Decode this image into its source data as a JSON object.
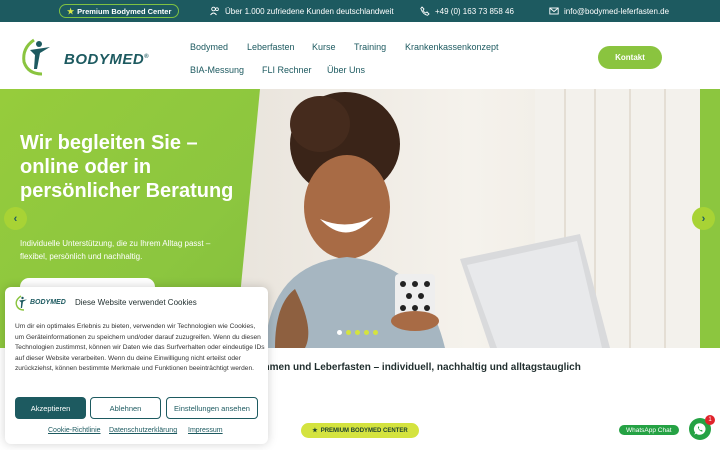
{
  "topbar": {
    "badge": "Premium Bodymed Center",
    "customers": "Über 1.000 zufriedene Kunden deutschlandweit",
    "phone": "+49 (0) 163 73 858 46",
    "email": "info@bodymed-leferfasten.de"
  },
  "header": {
    "logo_text": "BODYMED",
    "logo_mark": "®",
    "nav": [
      "Bodymed",
      "Leberfasten",
      "Kurse",
      "Training",
      "Krankenkassenkonzept",
      "BIA-Messung",
      "FLI Rechner",
      "Über Uns"
    ],
    "contact_button": "Kontakt"
  },
  "hero": {
    "title": "Wir begleiten Sie – online oder in persönlicher Beratung",
    "subtitle": "Individuelle Unterstützung, die zu Ihrem Alltag passt – flexibel, persönlich und nachhaltig.",
    "prev_icon": "‹",
    "next_icon": "›",
    "slides_total": 5,
    "slide_active": 1
  },
  "intro_text": "ehmen und Leberfasten – individuell, nachhaltig und alltagstauglich",
  "premium_badge": "PREMIUM BODYMED CENTER",
  "whatsapp": {
    "label": "WhatsApp Chat",
    "count": "1"
  },
  "cookie": {
    "logo_text": "BODYMED",
    "title": "Diese Website verwendet Cookies",
    "text": "Um dir ein optimales Erlebnis zu bieten, verwenden wir Technologien wie Cookies, um Geräteinformationen zu speichern und/oder darauf zuzugreifen. Wenn du diesen Technologien zustimmst, können wir Daten wie das Surfverhalten oder eindeutige IDs auf dieser Website verarbeiten. Wenn du deine Einwilligung nicht erteilst oder zurückziehst, können bestimmte Merkmale und Funktionen beeinträchtigt werden.",
    "accept": "Akzeptieren",
    "decline": "Ablehnen",
    "settings": "Einstellungen ansehen",
    "links": [
      "Cookie-Richtlinie",
      "Datenschutzerklärung",
      "Impressum"
    ]
  },
  "colors": {
    "primary": "#1d5a60",
    "accent": "#8ac43f",
    "highlight": "#d4e33f",
    "whatsapp": "#25a244"
  }
}
